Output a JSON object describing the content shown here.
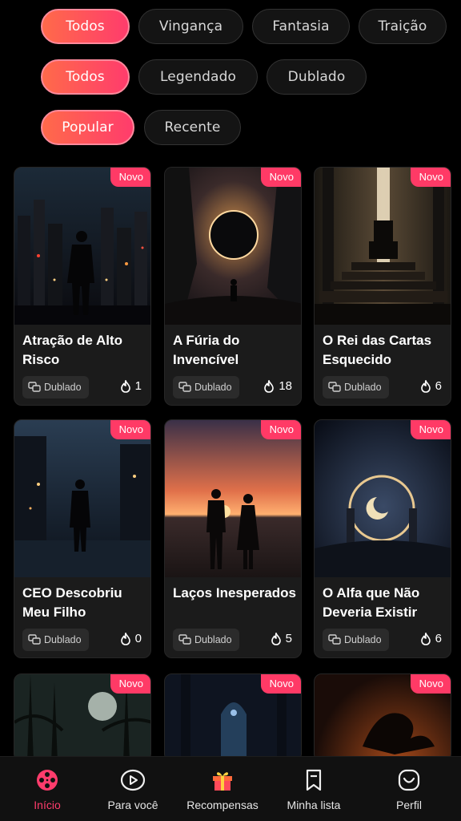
{
  "filters": {
    "row1": [
      "Todos",
      "Vingança",
      "Fantasia",
      "Traição"
    ],
    "row2": [
      "Todos",
      "Legendado",
      "Dublado"
    ],
    "row3": [
      "Popular",
      "Recente"
    ]
  },
  "cards": [
    {
      "badge": "Novo",
      "title": "Atração de Alto Risco",
      "tag": "Dublado",
      "count": "1"
    },
    {
      "badge": "Novo",
      "title": "A Fúria do Invencível",
      "tag": "Dublado",
      "count": "18"
    },
    {
      "badge": "Novo",
      "title": "O Rei das Cartas Esquecido",
      "tag": "Dublado",
      "count": "6"
    },
    {
      "badge": "Novo",
      "title": "CEO Descobriu Meu Filho",
      "tag": "Dublado",
      "count": "0"
    },
    {
      "badge": "Novo",
      "title": "Laços Inesperados",
      "tag": "Dublado",
      "count": "5"
    },
    {
      "badge": "Novo",
      "title": "O Alfa que Não Deveria Existir",
      "tag": "Dublado",
      "count": "6"
    },
    {
      "badge": "Novo"
    },
    {
      "badge": "Novo"
    },
    {
      "badge": "Novo"
    }
  ],
  "tabs": [
    {
      "label": "Início",
      "icon": "film-reel-icon"
    },
    {
      "label": "Para você",
      "icon": "play-circle-icon"
    },
    {
      "label": "Recompensas",
      "icon": "gift-icon"
    },
    {
      "label": "Minha lista",
      "icon": "bookmark-icon"
    },
    {
      "label": "Perfil",
      "icon": "profile-face-icon"
    }
  ],
  "colors": {
    "accent": "#ff3c6c",
    "gradient_start": "#ff6a4a",
    "badge": "#ff3a66",
    "background": "#000000"
  }
}
